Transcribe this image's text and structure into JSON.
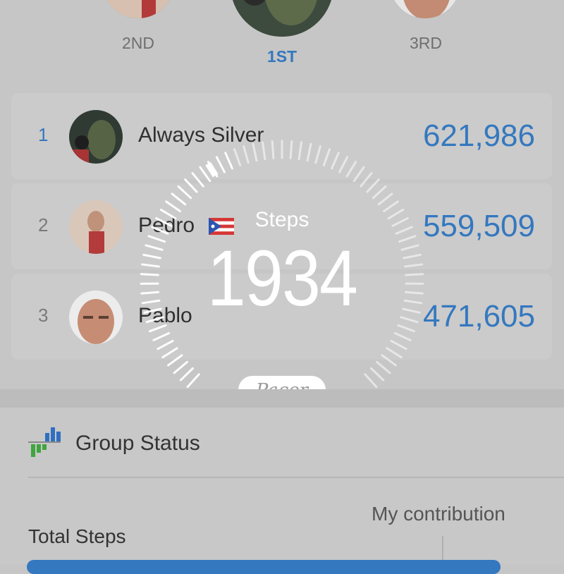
{
  "podium": {
    "second_label": "2ND",
    "first_label": "1ST",
    "third_label": "3RD"
  },
  "leaderboard": [
    {
      "rank": "1",
      "name": "Always Silver",
      "steps": "621,986"
    },
    {
      "rank": "2",
      "name": "Pedro",
      "steps": "559,509",
      "flag": "puerto-rico-flag"
    },
    {
      "rank": "3",
      "name": "Pablo",
      "steps": "471,605"
    }
  ],
  "dial": {
    "title": "Steps",
    "value": "1934"
  },
  "brand": "Pacer",
  "group_status": {
    "title": "Group Status",
    "my_contribution_label": "My contribution",
    "total_steps_label": "Total Steps"
  },
  "colors": {
    "accent": "#3478bf",
    "background": "#c6c6c6",
    "card": "#cbcbcb"
  }
}
